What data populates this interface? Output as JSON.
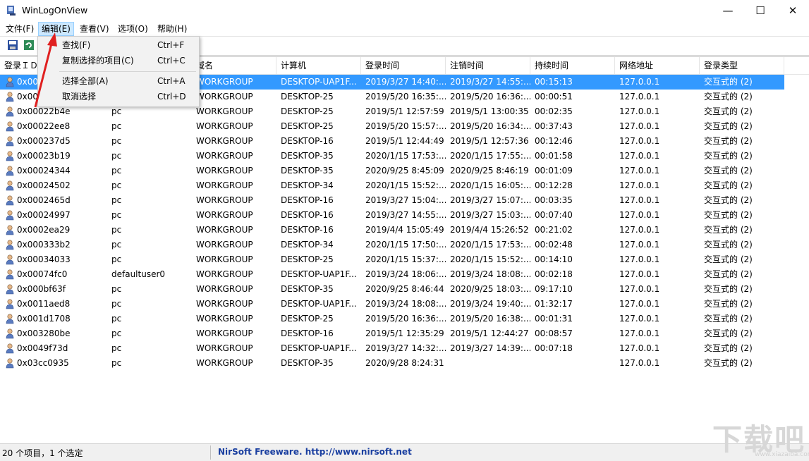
{
  "window": {
    "title": "WinLogOnView",
    "minimize": "—",
    "maximize": "☐",
    "close": "✕"
  },
  "menu": [
    {
      "label": "文件(F)"
    },
    {
      "label": "编辑(E)",
      "active": true
    },
    {
      "label": "查看(V)"
    },
    {
      "label": "选项(O)"
    },
    {
      "label": "帮助(H)"
    }
  ],
  "dropdown": {
    "items": [
      {
        "label": "查找(F)",
        "shortcut": "Ctrl+F"
      },
      {
        "label": "复制选择的项目(C)",
        "shortcut": "Ctrl+C"
      },
      {
        "label": "选择全部(A)",
        "shortcut": "Ctrl+A"
      },
      {
        "label": "取消选择",
        "shortcut": "Ctrl+D"
      }
    ]
  },
  "columns": [
    "登录ＩＤ",
    "",
    "域名",
    "计算机",
    "登录时间",
    "注销时间",
    "持续时间",
    "网络地址",
    "登录类型"
  ],
  "rows": [
    [
      "0x000",
      "",
      "WORKGROUP",
      "DESKTOP-UAP1F...",
      "2019/3/27 14:40:...",
      "2019/3/27 14:55:...",
      "00:15:13",
      "127.0.0.1",
      "交互式的 (2)"
    ],
    [
      "0x000",
      "",
      "WORKGROUP",
      "DESKTOP-25",
      "2019/5/20 16:35:...",
      "2019/5/20 16:36:...",
      "00:00:51",
      "127.0.0.1",
      "交互式的 (2)"
    ],
    [
      "0x00022b4e",
      "pc",
      "WORKGROUP",
      "DESKTOP-25",
      "2019/5/1 12:57:59",
      "2019/5/1 13:00:35",
      "00:02:35",
      "127.0.0.1",
      "交互式的 (2)"
    ],
    [
      "0x00022ee8",
      "pc",
      "WORKGROUP",
      "DESKTOP-25",
      "2019/5/20 15:57:...",
      "2019/5/20 16:34:...",
      "00:37:43",
      "127.0.0.1",
      "交互式的 (2)"
    ],
    [
      "0x000237d5",
      "pc",
      "WORKGROUP",
      "DESKTOP-16",
      "2019/5/1 12:44:49",
      "2019/5/1 12:57:36",
      "00:12:46",
      "127.0.0.1",
      "交互式的 (2)"
    ],
    [
      "0x00023b19",
      "pc",
      "WORKGROUP",
      "DESKTOP-35",
      "2020/1/15 17:53:...",
      "2020/1/15 17:55:...",
      "00:01:58",
      "127.0.0.1",
      "交互式的 (2)"
    ],
    [
      "0x00024344",
      "pc",
      "WORKGROUP",
      "DESKTOP-35",
      "2020/9/25 8:45:09",
      "2020/9/25 8:46:19",
      "00:01:09",
      "127.0.0.1",
      "交互式的 (2)"
    ],
    [
      "0x00024502",
      "pc",
      "WORKGROUP",
      "DESKTOP-34",
      "2020/1/15 15:52:...",
      "2020/1/15 16:05:...",
      "00:12:28",
      "127.0.0.1",
      "交互式的 (2)"
    ],
    [
      "0x0002465d",
      "pc",
      "WORKGROUP",
      "DESKTOP-16",
      "2019/3/27 15:04:...",
      "2019/3/27 15:07:...",
      "00:03:35",
      "127.0.0.1",
      "交互式的 (2)"
    ],
    [
      "0x00024997",
      "pc",
      "WORKGROUP",
      "DESKTOP-16",
      "2019/3/27 14:55:...",
      "2019/3/27 15:03:...",
      "00:07:40",
      "127.0.0.1",
      "交互式的 (2)"
    ],
    [
      "0x0002ea29",
      "pc",
      "WORKGROUP",
      "DESKTOP-16",
      "2019/4/4 15:05:49",
      "2019/4/4 15:26:52",
      "00:21:02",
      "127.0.0.1",
      "交互式的 (2)"
    ],
    [
      "0x000333b2",
      "pc",
      "WORKGROUP",
      "DESKTOP-34",
      "2020/1/15 17:50:...",
      "2020/1/15 17:53:...",
      "00:02:48",
      "127.0.0.1",
      "交互式的 (2)"
    ],
    [
      "0x00034033",
      "pc",
      "WORKGROUP",
      "DESKTOP-25",
      "2020/1/15 15:37:...",
      "2020/1/15 15:52:...",
      "00:14:10",
      "127.0.0.1",
      "交互式的 (2)"
    ],
    [
      "0x00074fc0",
      "defaultuser0",
      "WORKGROUP",
      "DESKTOP-UAP1F...",
      "2019/3/24 18:06:...",
      "2019/3/24 18:08:...",
      "00:02:18",
      "127.0.0.1",
      "交互式的 (2)"
    ],
    [
      "0x000bf63f",
      "pc",
      "WORKGROUP",
      "DESKTOP-35",
      "2020/9/25 8:46:44",
      "2020/9/25 18:03:...",
      "09:17:10",
      "127.0.0.1",
      "交互式的 (2)"
    ],
    [
      "0x0011aed8",
      "pc",
      "WORKGROUP",
      "DESKTOP-UAP1F...",
      "2019/3/24 18:08:...",
      "2019/3/24 19:40:...",
      "01:32:17",
      "127.0.0.1",
      "交互式的 (2)"
    ],
    [
      "0x001d1708",
      "pc",
      "WORKGROUP",
      "DESKTOP-25",
      "2019/5/20 16:36:...",
      "2019/5/20 16:38:...",
      "00:01:31",
      "127.0.0.1",
      "交互式的 (2)"
    ],
    [
      "0x003280be",
      "pc",
      "WORKGROUP",
      "DESKTOP-16",
      "2019/5/1 12:35:29",
      "2019/5/1 12:44:27",
      "00:08:57",
      "127.0.0.1",
      "交互式的 (2)"
    ],
    [
      "0x0049f73d",
      "pc",
      "WORKGROUP",
      "DESKTOP-UAP1F...",
      "2019/3/27 14:32:...",
      "2019/3/27 14:39:...",
      "00:07:18",
      "127.0.0.1",
      "交互式的 (2)"
    ],
    [
      "0x03cc0935",
      "pc",
      "WORKGROUP",
      "DESKTOP-35",
      "2020/9/28 8:24:31",
      "",
      "",
      "127.0.0.1",
      "交互式的 (2)"
    ]
  ],
  "selected_row": 0,
  "status": {
    "count": "20 个项目，1 个选定",
    "link": "NirSoft Freeware.  http://www.nirsoft.net"
  },
  "watermark": "下载吧",
  "watermark_url": "www.xiazaiba.com",
  "colors": {
    "selection": "#3399ff",
    "arrow": "#e02020",
    "link": "#1a3fa0"
  }
}
